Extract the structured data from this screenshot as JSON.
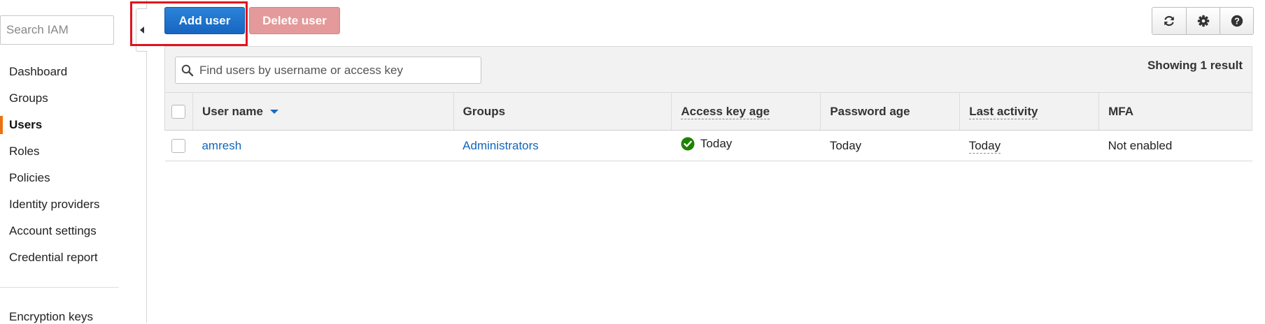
{
  "sidebar": {
    "search_placeholder": "Search IAM",
    "items": [
      {
        "label": "Dashboard",
        "active": false
      },
      {
        "label": "Groups",
        "active": false
      },
      {
        "label": "Users",
        "active": true
      },
      {
        "label": "Roles",
        "active": false
      },
      {
        "label": "Policies",
        "active": false
      },
      {
        "label": "Identity providers",
        "active": false
      },
      {
        "label": "Account settings",
        "active": false
      },
      {
        "label": "Credential report",
        "active": false
      }
    ],
    "extra_item": "Encryption keys",
    "active_accent": "#ec7211"
  },
  "toolbar": {
    "add_user_label": "Add user",
    "delete_user_label": "Delete user",
    "icons": [
      "refresh-icon",
      "gear-icon",
      "help-icon"
    ],
    "highlight_color": "#e0131d"
  },
  "users_panel": {
    "filter_placeholder": "Find users by username or access key",
    "result_count": "Showing 1 result",
    "columns": {
      "user_name": "User name",
      "groups": "Groups",
      "access_key_age": "Access key age",
      "password_age": "Password age",
      "last_activity": "Last activity",
      "mfa": "MFA"
    },
    "rows": [
      {
        "user_name": "amresh",
        "groups": "Administrators",
        "access_key_age": "Today",
        "access_key_status": "ok",
        "password_age": "Today",
        "last_activity": "Today",
        "mfa": "Not enabled"
      }
    ]
  }
}
